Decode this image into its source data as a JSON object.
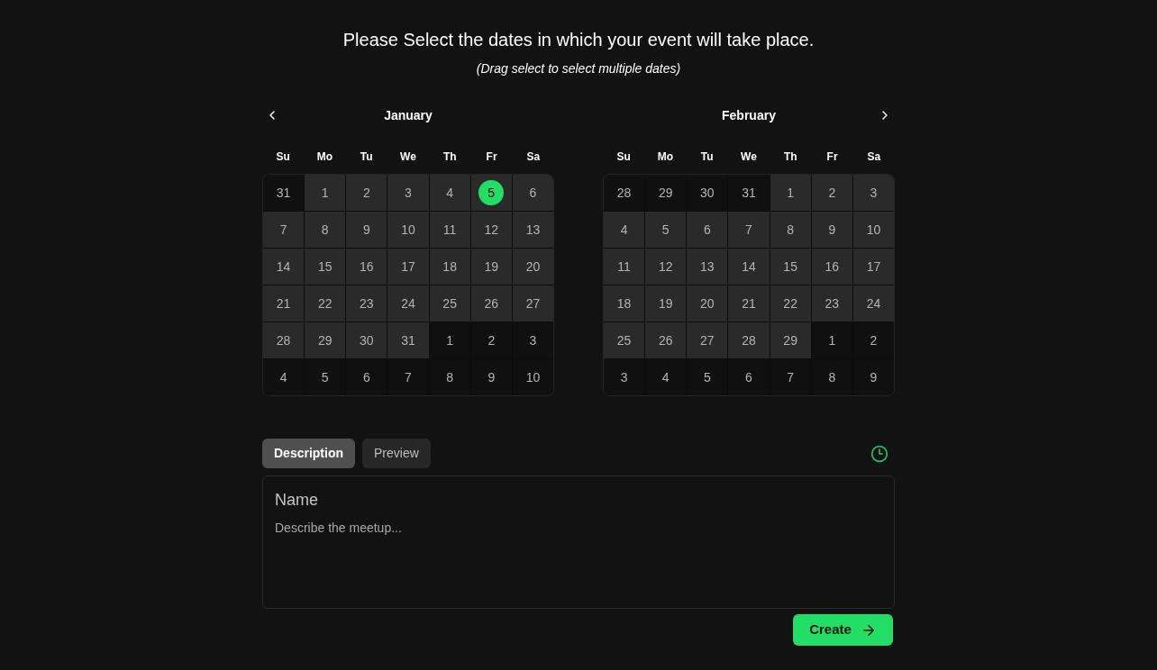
{
  "heading": "Please Select the dates in which your event will take place.",
  "subheading": "(Drag select to select multiple dates)",
  "calendars": [
    {
      "month": "January",
      "weekdays": [
        "Su",
        "Mo",
        "Tu",
        "We",
        "Th",
        "Fr",
        "Sa"
      ],
      "days": [
        {
          "day": "31",
          "in_month": false,
          "selected": false
        },
        {
          "day": "1",
          "in_month": true,
          "selected": false
        },
        {
          "day": "2",
          "in_month": true,
          "selected": false
        },
        {
          "day": "3",
          "in_month": true,
          "selected": false
        },
        {
          "day": "4",
          "in_month": true,
          "selected": false
        },
        {
          "day": "5",
          "in_month": true,
          "selected": true
        },
        {
          "day": "6",
          "in_month": true,
          "selected": false
        },
        {
          "day": "7",
          "in_month": true,
          "selected": false
        },
        {
          "day": "8",
          "in_month": true,
          "selected": false
        },
        {
          "day": "9",
          "in_month": true,
          "selected": false
        },
        {
          "day": "10",
          "in_month": true,
          "selected": false
        },
        {
          "day": "11",
          "in_month": true,
          "selected": false
        },
        {
          "day": "12",
          "in_month": true,
          "selected": false
        },
        {
          "day": "13",
          "in_month": true,
          "selected": false
        },
        {
          "day": "14",
          "in_month": true,
          "selected": false
        },
        {
          "day": "15",
          "in_month": true,
          "selected": false
        },
        {
          "day": "16",
          "in_month": true,
          "selected": false
        },
        {
          "day": "17",
          "in_month": true,
          "selected": false
        },
        {
          "day": "18",
          "in_month": true,
          "selected": false
        },
        {
          "day": "19",
          "in_month": true,
          "selected": false
        },
        {
          "day": "20",
          "in_month": true,
          "selected": false
        },
        {
          "day": "21",
          "in_month": true,
          "selected": false
        },
        {
          "day": "22",
          "in_month": true,
          "selected": false
        },
        {
          "day": "23",
          "in_month": true,
          "selected": false
        },
        {
          "day": "24",
          "in_month": true,
          "selected": false
        },
        {
          "day": "25",
          "in_month": true,
          "selected": false
        },
        {
          "day": "26",
          "in_month": true,
          "selected": false
        },
        {
          "day": "27",
          "in_month": true,
          "selected": false
        },
        {
          "day": "28",
          "in_month": true,
          "selected": false
        },
        {
          "day": "29",
          "in_month": true,
          "selected": false
        },
        {
          "day": "30",
          "in_month": true,
          "selected": false
        },
        {
          "day": "31",
          "in_month": true,
          "selected": false
        },
        {
          "day": "1",
          "in_month": false,
          "selected": false
        },
        {
          "day": "2",
          "in_month": false,
          "selected": false
        },
        {
          "day": "3",
          "in_month": false,
          "selected": false
        },
        {
          "day": "4",
          "in_month": false,
          "selected": false
        },
        {
          "day": "5",
          "in_month": false,
          "selected": false
        },
        {
          "day": "6",
          "in_month": false,
          "selected": false
        },
        {
          "day": "7",
          "in_month": false,
          "selected": false
        },
        {
          "day": "8",
          "in_month": false,
          "selected": false
        },
        {
          "day": "9",
          "in_month": false,
          "selected": false
        },
        {
          "day": "10",
          "in_month": false,
          "selected": false
        }
      ]
    },
    {
      "month": "February",
      "weekdays": [
        "Su",
        "Mo",
        "Tu",
        "We",
        "Th",
        "Fr",
        "Sa"
      ],
      "days": [
        {
          "day": "28",
          "in_month": false,
          "selected": false
        },
        {
          "day": "29",
          "in_month": false,
          "selected": false
        },
        {
          "day": "30",
          "in_month": false,
          "selected": false
        },
        {
          "day": "31",
          "in_month": false,
          "selected": false
        },
        {
          "day": "1",
          "in_month": true,
          "selected": false
        },
        {
          "day": "2",
          "in_month": true,
          "selected": false
        },
        {
          "day": "3",
          "in_month": true,
          "selected": false
        },
        {
          "day": "4",
          "in_month": true,
          "selected": false
        },
        {
          "day": "5",
          "in_month": true,
          "selected": false
        },
        {
          "day": "6",
          "in_month": true,
          "selected": false
        },
        {
          "day": "7",
          "in_month": true,
          "selected": false
        },
        {
          "day": "8",
          "in_month": true,
          "selected": false
        },
        {
          "day": "9",
          "in_month": true,
          "selected": false
        },
        {
          "day": "10",
          "in_month": true,
          "selected": false
        },
        {
          "day": "11",
          "in_month": true,
          "selected": false
        },
        {
          "day": "12",
          "in_month": true,
          "selected": false
        },
        {
          "day": "13",
          "in_month": true,
          "selected": false
        },
        {
          "day": "14",
          "in_month": true,
          "selected": false
        },
        {
          "day": "15",
          "in_month": true,
          "selected": false
        },
        {
          "day": "16",
          "in_month": true,
          "selected": false
        },
        {
          "day": "17",
          "in_month": true,
          "selected": false
        },
        {
          "day": "18",
          "in_month": true,
          "selected": false
        },
        {
          "day": "19",
          "in_month": true,
          "selected": false
        },
        {
          "day": "20",
          "in_month": true,
          "selected": false
        },
        {
          "day": "21",
          "in_month": true,
          "selected": false
        },
        {
          "day": "22",
          "in_month": true,
          "selected": false
        },
        {
          "day": "23",
          "in_month": true,
          "selected": false
        },
        {
          "day": "24",
          "in_month": true,
          "selected": false
        },
        {
          "day": "25",
          "in_month": true,
          "selected": false
        },
        {
          "day": "26",
          "in_month": true,
          "selected": false
        },
        {
          "day": "27",
          "in_month": true,
          "selected": false
        },
        {
          "day": "28",
          "in_month": true,
          "selected": false
        },
        {
          "day": "29",
          "in_month": true,
          "selected": false
        },
        {
          "day": "1",
          "in_month": false,
          "selected": false
        },
        {
          "day": "2",
          "in_month": false,
          "selected": false
        },
        {
          "day": "3",
          "in_month": false,
          "selected": false
        },
        {
          "day": "4",
          "in_month": false,
          "selected": false
        },
        {
          "day": "5",
          "in_month": false,
          "selected": false
        },
        {
          "day": "6",
          "in_month": false,
          "selected": false
        },
        {
          "day": "7",
          "in_month": false,
          "selected": false
        },
        {
          "day": "8",
          "in_month": false,
          "selected": false
        },
        {
          "day": "9",
          "in_month": false,
          "selected": false
        }
      ]
    }
  ],
  "tabs": [
    {
      "label": "Description",
      "selected": true
    },
    {
      "label": "Preview",
      "selected": false
    }
  ],
  "editor": {
    "name": {
      "placeholder": "Name"
    },
    "description": {
      "placeholder": "Describe the meetup..."
    }
  },
  "create_button": {
    "label": "Create"
  }
}
